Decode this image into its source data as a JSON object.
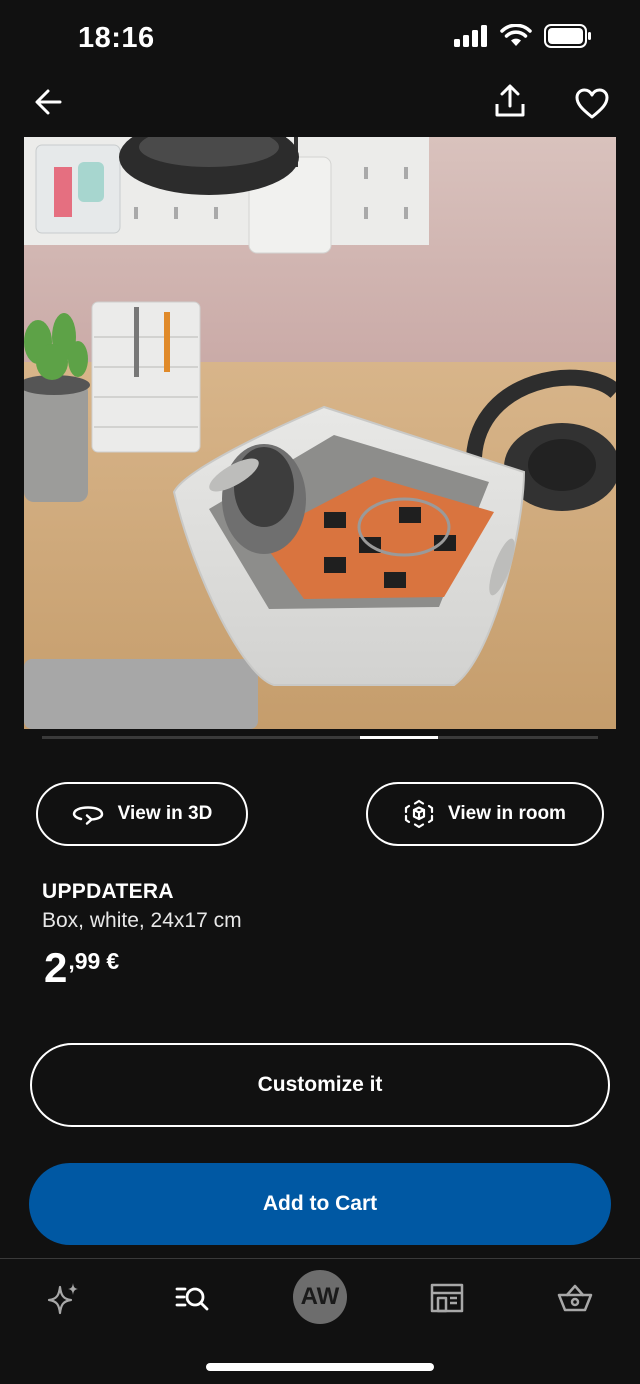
{
  "status_bar": {
    "time": "18:16"
  },
  "product": {
    "name": "UPPDATERA",
    "description": "Box, white, 24x17 cm",
    "price_int": "2",
    "price_dec": ",99",
    "currency": "€"
  },
  "actions": {
    "view_3d": "View in 3D",
    "view_room": "View in room",
    "customize": "Customize it",
    "add_to_cart": "Add to Cart"
  },
  "carousel": {
    "position_fraction": 0.57
  },
  "tab_bar": {
    "avatar_initials": "AW",
    "items": [
      "sparkle-icon",
      "search-list-icon",
      "avatar",
      "store-icon",
      "basket-icon"
    ]
  },
  "colors": {
    "background": "#111111",
    "cart_button": "#0058a3",
    "text": "#ffffff"
  }
}
